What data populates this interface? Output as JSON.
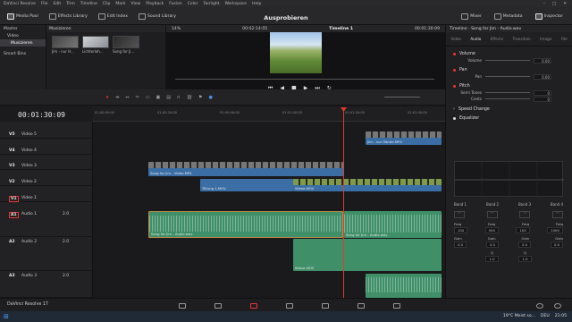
{
  "menu": [
    "DaVinci Resolve",
    "File",
    "Edit",
    "Trim",
    "Timeline",
    "Clip",
    "Mark",
    "View",
    "Playback",
    "Fusion",
    "Color",
    "Fairlight",
    "Workspace",
    "Help"
  ],
  "toolbar": {
    "media_pool": "Media Pool",
    "effects_library": "Effects Library",
    "edit_index": "Edit Index",
    "sound_library": "Sound Library",
    "project_title": "Ausprobieren",
    "mixer": "Mixer",
    "metadata": "Metadata",
    "inspector": "Inspector"
  },
  "left_panel": {
    "master": "Master",
    "video": "Video",
    "musizieren": "Musizieren",
    "smart_bins": "Smart Bins"
  },
  "pool": {
    "bin": "Musizieren",
    "clips": [
      {
        "label": "Jim - nur H..."
      },
      {
        "label": "Lichterloh..."
      },
      {
        "label": "Song for Ji..."
      }
    ]
  },
  "viewer": {
    "zoom": "14%",
    "timecode": "00:02:14:05",
    "timeline": "Timeline 1",
    "tc_right": "00:01:30:09"
  },
  "timeline": {
    "timecode": "00:01:30:09",
    "ruler": [
      "01:00:00:00",
      "01:00:20:00",
      "01:00:40:00",
      "01:01:00:00",
      "01:01:20:00",
      "01:01:40:00"
    ],
    "tracks": [
      {
        "tag": "V5",
        "name": "Video 5"
      },
      {
        "tag": "V4",
        "name": "Video 4"
      },
      {
        "tag": "V3",
        "name": "Video 3"
      },
      {
        "tag": "V2",
        "name": "Video 2"
      },
      {
        "tag": "V1",
        "name": "Video 1"
      },
      {
        "tag": "A1",
        "name": "Audio 1",
        "ch": "2.0"
      },
      {
        "tag": "A2",
        "name": "Audio 2",
        "ch": "2.0"
      },
      {
        "tag": "A3",
        "name": "Audio 3",
        "ch": "2.0"
      }
    ],
    "clips": {
      "v5": "Jim - nur Hände.MP4",
      "v3": "Song for Jim - Video.MP4",
      "v2a": "Tiltung 1.MOV",
      "v2b": "Wiese.MOV",
      "a1a": "Song for Jim - Audio.wav",
      "a1b": "Song for Jim - Audio.wav",
      "a2": "Wiese.MOV"
    }
  },
  "inspector": {
    "title": "Timeline - Song for Jim - Audio.wav",
    "tabs": [
      "Video",
      "Audio",
      "Effects",
      "Transition",
      "Image",
      "File"
    ],
    "volume": "Volume",
    "volume_val": "0.00",
    "pan": "Pan",
    "pan_val": "0.00",
    "pitch": "Pitch",
    "semi_tones": "Semi Tones",
    "cents": "Cents",
    "semi_val": "0",
    "cents_val": "0",
    "speed_change": "Speed Change",
    "equalizer": "Equalizer",
    "bands": [
      "Band 1",
      "Band 2",
      "Band 3",
      "Band 4"
    ],
    "freq_label": "Freq",
    "gain_label": "Gain",
    "q_label": "Q",
    "freq": [
      "100",
      "500",
      "1K5",
      "10K0"
    ],
    "gain": [
      "0.0",
      "0.0",
      "0.0",
      "0.0"
    ],
    "q": [
      "1.0",
      "1.0"
    ]
  },
  "pagenav": {
    "app": "DaVinci Resolve 17"
  },
  "taskbar": {
    "weather": "19°C  Meist so...",
    "lang": "DEU",
    "time": "21:05"
  },
  "colors": {
    "video_clip": "#3b6ea5",
    "audio_clip": "#3f8f68",
    "playhead": "#e03a2e"
  }
}
